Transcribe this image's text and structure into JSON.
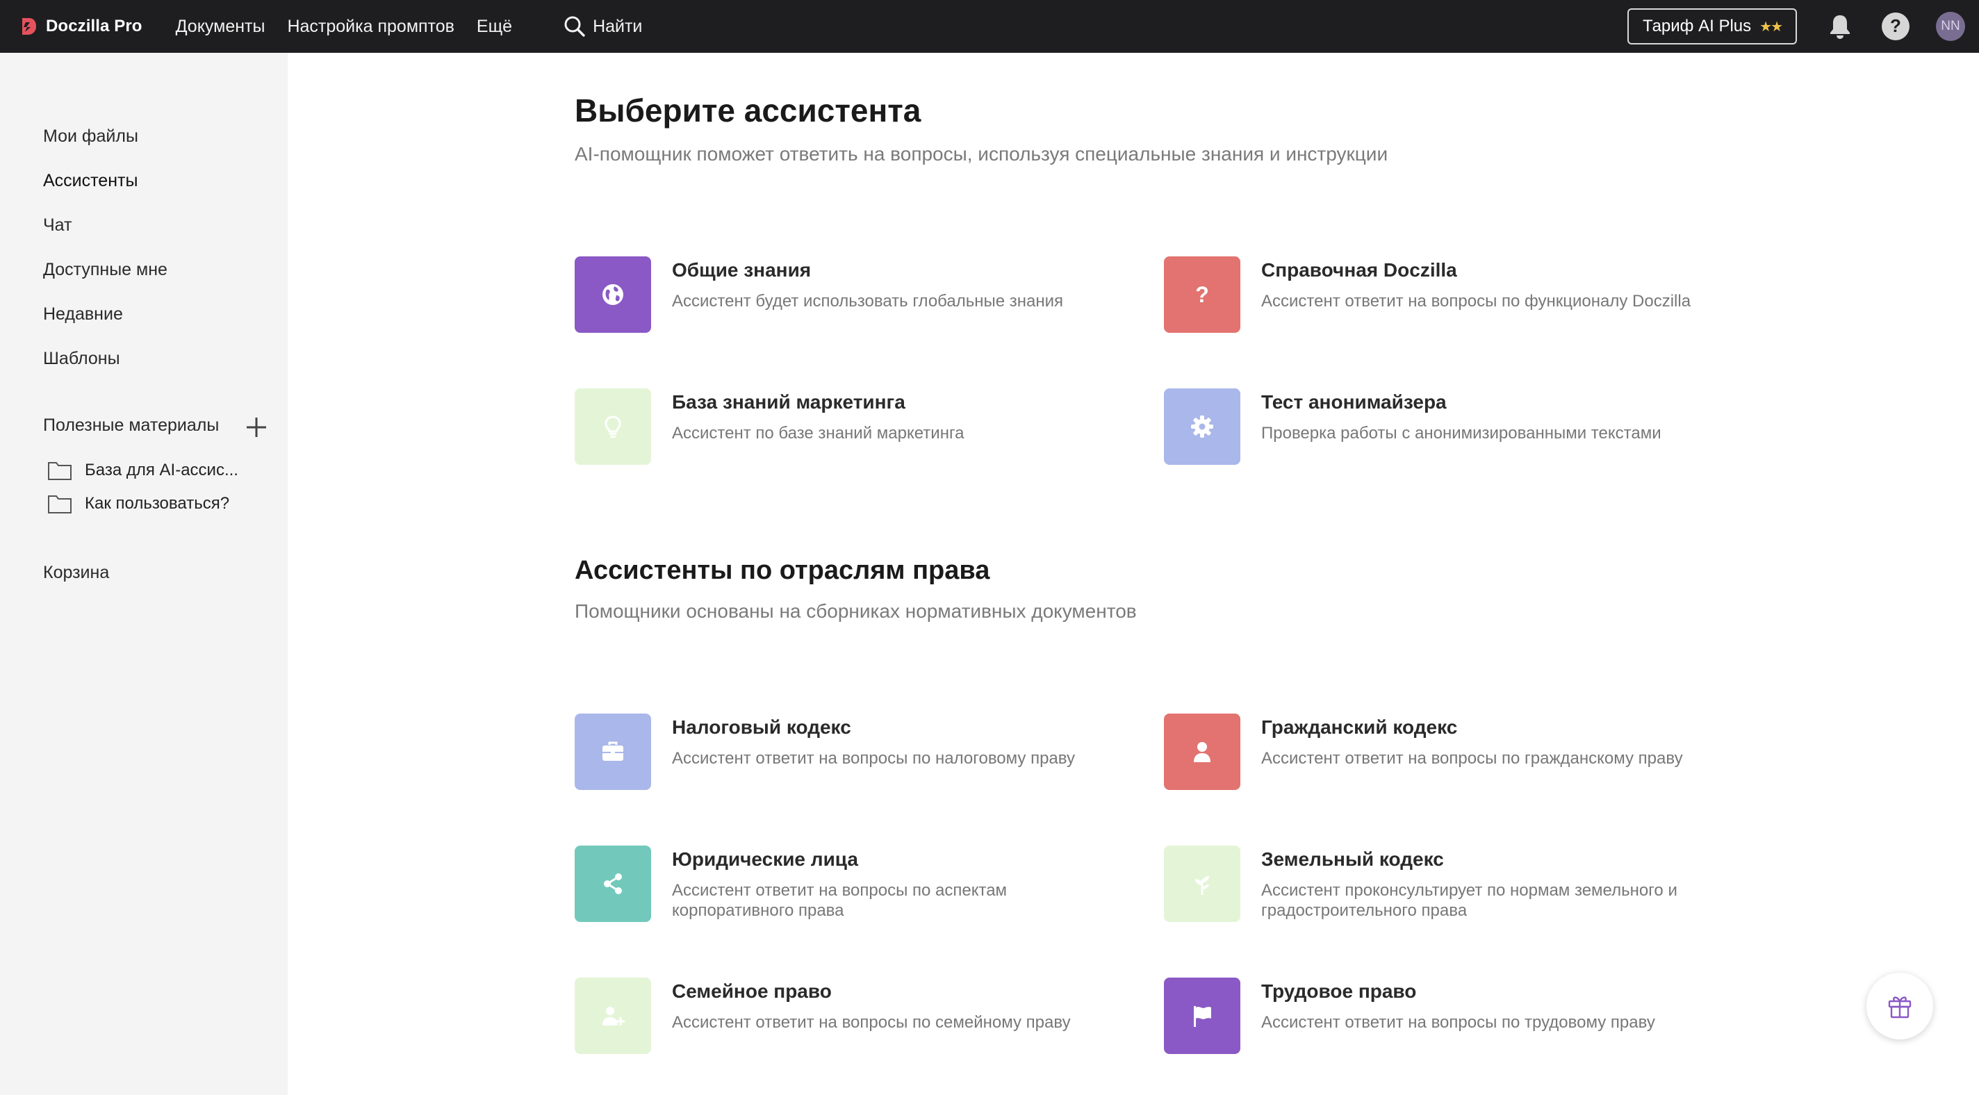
{
  "app": {
    "name": "Doczilla Pro"
  },
  "topnav": {
    "documents": "Документы",
    "prompts": "Настройка промптов",
    "more": "Ещё",
    "search": "Найти"
  },
  "topright": {
    "tariff": "Тариф AI Plus",
    "tariff_stars": "★★",
    "avatar": "NN"
  },
  "sidebar": {
    "items": [
      "Мои файлы",
      "Ассистенты",
      "Чат",
      "Доступные мне",
      "Недавние",
      "Шаблоны"
    ],
    "useful_title": "Полезные материалы",
    "folders": [
      "База для AI-ассис...",
      "Как пользоваться?"
    ],
    "trash": "Корзина"
  },
  "main": {
    "title": "Выберите ассистента",
    "subtitle": "AI-помощник поможет ответить на вопросы, используя специальные знания и инструкции",
    "general": [
      {
        "title": "Общие знания",
        "desc": "Ассистент будет использовать глобальные знания",
        "color": "#8a59c5",
        "icon": "globe-icon"
      },
      {
        "title": "Справочная Doczilla",
        "desc": "Ассистент ответит на вопросы по функционалу Doczilla",
        "color": "#e27370",
        "icon": "question-icon"
      },
      {
        "title": "База знаний маркетинга",
        "desc": "Ассистент по базе знаний маркетинга",
        "color": "#e3f5d6",
        "icon": "lightbulb-icon"
      },
      {
        "title": "Тест анонимайзера",
        "desc": "Проверка работы с анонимизированными текстами",
        "color": "#aab7ea",
        "icon": "gear-icon"
      }
    ],
    "law_title": "Ассистенты по отраслям права",
    "law_subtitle": "Помощники основаны на сборниках нормативных документов",
    "law": [
      {
        "title": "Налоговый кодекс",
        "desc": "Ассистент ответит на вопросы по налоговому праву",
        "color": "#aab7ea",
        "icon": "briefcase-icon"
      },
      {
        "title": "Гражданский кодекс",
        "desc": "Ассистент ответит на вопросы по гражданскому праву",
        "color": "#e27370",
        "icon": "person-icon"
      },
      {
        "title": "Юридические лица",
        "desc": "Ассистент ответит на вопросы по аспектам корпоративного права",
        "color": "#72c9bb",
        "icon": "share-icon"
      },
      {
        "title": "Земельный кодекс",
        "desc": "Ассистент проконсультирует по нормам земельного и градостроительного права",
        "color": "#e3f5d6",
        "icon": "sprout-icon"
      },
      {
        "title": "Семейное право",
        "desc": "Ассистент ответит на вопросы по семейному праву",
        "color": "#e3f5d6",
        "icon": "add-user-icon"
      },
      {
        "title": "Трудовое право",
        "desc": "Ассистент ответит на вопросы по трудовому праву",
        "color": "#8a59c5",
        "icon": "flag-icon"
      }
    ]
  }
}
